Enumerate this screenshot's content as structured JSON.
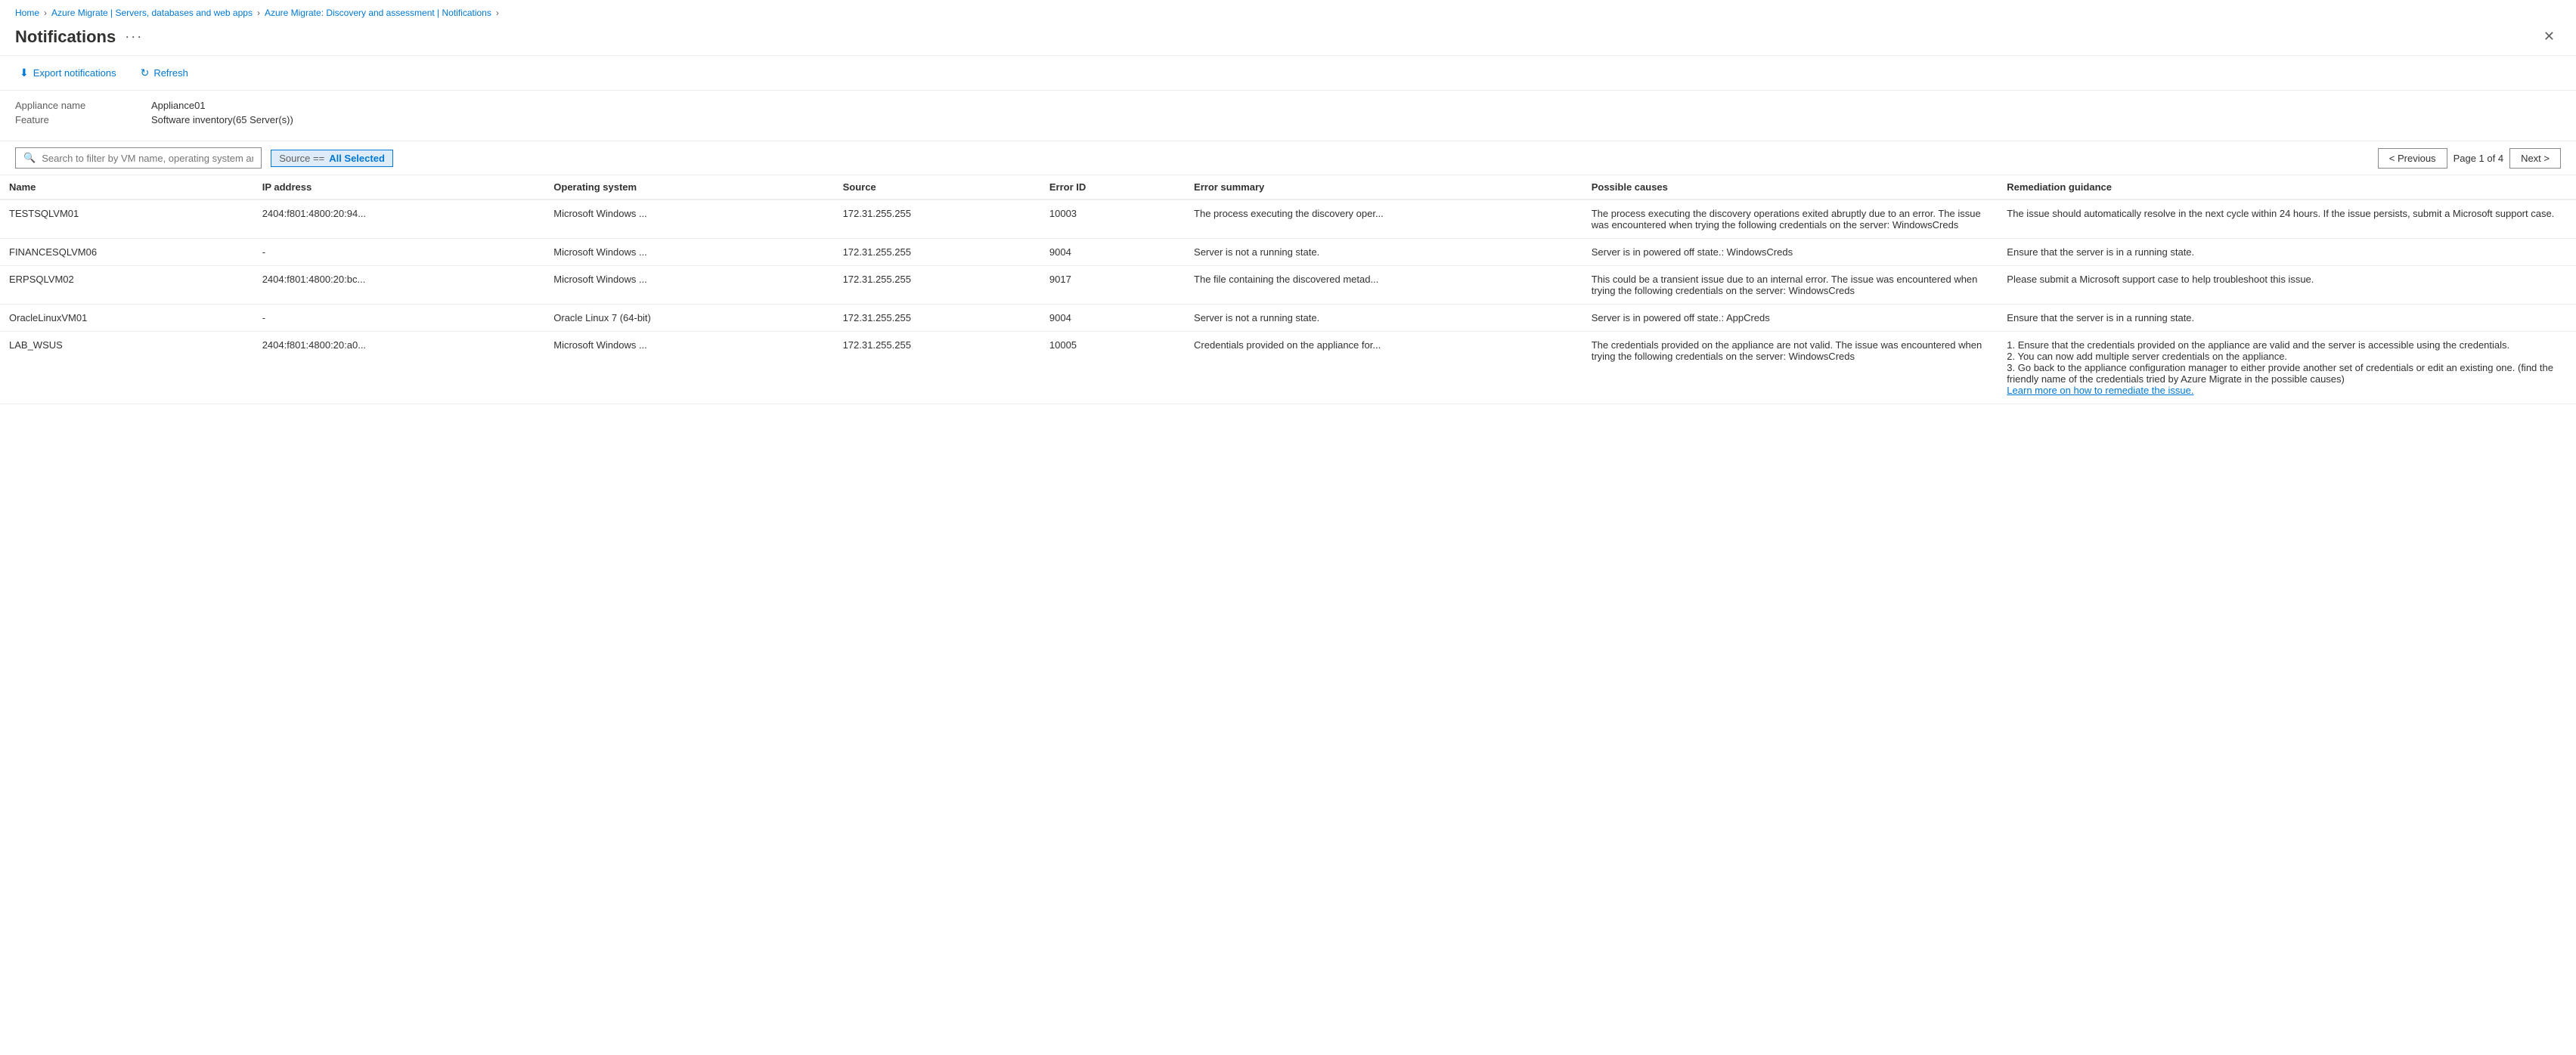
{
  "breadcrumb": {
    "items": [
      {
        "label": "Home",
        "href": "#"
      },
      {
        "sep": ">"
      },
      {
        "label": "Azure Migrate | Servers, databases and web apps",
        "href": "#"
      },
      {
        "sep": ">"
      },
      {
        "label": "Azure Migrate: Discovery and assessment | Notifications",
        "href": "#"
      },
      {
        "sep": ">"
      }
    ]
  },
  "page": {
    "title": "Notifications",
    "more_icon": "···"
  },
  "toolbar": {
    "export_label": "Export notifications",
    "refresh_label": "Refresh"
  },
  "meta": {
    "appliance_label": "Appliance name",
    "appliance_value": "Appliance01",
    "feature_label": "Feature",
    "feature_value": "Software inventory(65 Server(s))"
  },
  "filter": {
    "search_placeholder": "Search to filter by VM name, operating system and error ID",
    "source_filter_prefix": "Source ==",
    "source_filter_value": "All Selected"
  },
  "pagination": {
    "previous_label": "< Previous",
    "page_info": "Page 1 of 4",
    "next_label": "Next >"
  },
  "table": {
    "columns": [
      {
        "key": "name",
        "label": "Name"
      },
      {
        "key": "ip",
        "label": "IP address"
      },
      {
        "key": "os",
        "label": "Operating system"
      },
      {
        "key": "source",
        "label": "Source"
      },
      {
        "key": "error_id",
        "label": "Error ID"
      },
      {
        "key": "error_summary",
        "label": "Error summary"
      },
      {
        "key": "causes",
        "label": "Possible causes"
      },
      {
        "key": "remediation",
        "label": "Remediation guidance"
      }
    ],
    "rows": [
      {
        "name": "TESTSQLVM01",
        "ip": "2404:f801:4800:20:94...",
        "os": "Microsoft Windows ...",
        "source": "172.31.255.255",
        "error_id": "10003",
        "error_summary": "The process executing the discovery oper...",
        "causes": "The process executing the discovery operations exited abruptly due to an error. The issue was encountered when trying the following credentials on the server: WindowsCreds",
        "remediation": "The issue should automatically resolve in the next cycle within 24 hours. If the issue persists, submit a Microsoft support case.",
        "remediation_link": null
      },
      {
        "name": "FINANCESQLVM06",
        "ip": "-",
        "os": "Microsoft Windows ...",
        "source": "172.31.255.255",
        "error_id": "9004",
        "error_summary": "Server is not a running state.",
        "causes": "Server is in powered off state.: WindowsCreds",
        "remediation": "Ensure that the server is in a running state.",
        "remediation_link": null
      },
      {
        "name": "ERPSQLVM02",
        "ip": "2404:f801:4800:20:bc...",
        "os": "Microsoft Windows ...",
        "source": "172.31.255.255",
        "error_id": "9017",
        "error_summary": "The file containing the discovered metad...",
        "causes": "This could be a transient issue due to an internal error. The issue was encountered when trying the following credentials on the server: WindowsCreds",
        "remediation": "Please submit a Microsoft support case to help troubleshoot this issue.",
        "remediation_link": null
      },
      {
        "name": "OracleLinuxVM01",
        "ip": "-",
        "os": "Oracle Linux 7 (64-bit)",
        "source": "172.31.255.255",
        "error_id": "9004",
        "error_summary": "Server is not a running state.",
        "causes": "Server is in powered off state.: AppCreds",
        "remediation": "Ensure that the server is in a running state.",
        "remediation_link": null
      },
      {
        "name": "LAB_WSUS",
        "ip": "2404:f801:4800:20:a0...",
        "os": "Microsoft Windows ...",
        "source": "172.31.255.255",
        "error_id": "10005",
        "error_summary": "Credentials provided on the appliance for...",
        "causes": "The credentials provided on the appliance are not valid. The issue was encountered when trying the following credentials on the server: WindowsCreds",
        "remediation": "1. Ensure that the credentials provided on the appliance are valid and the server is accessible using the credentials.\n2. You can now add multiple server credentials on the appliance.\n3. Go back to the appliance configuration manager to either provide another set of credentials or edit an existing one. (find the friendly name of the credentials tried by Azure Migrate in the possible causes)",
        "remediation_link": "Learn more"
      }
    ]
  }
}
